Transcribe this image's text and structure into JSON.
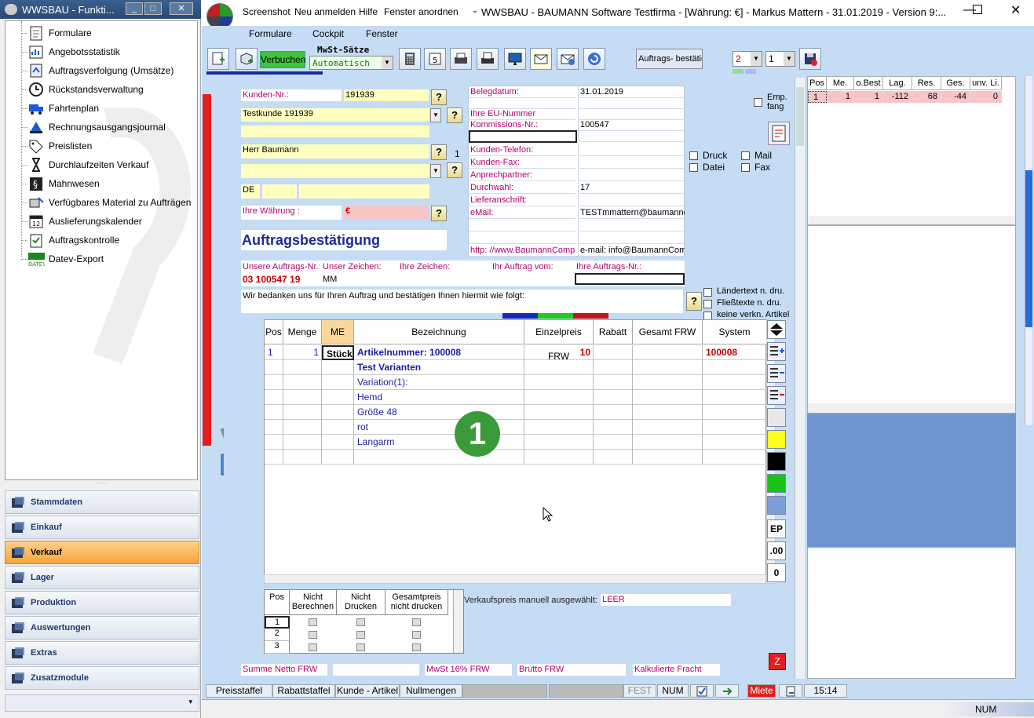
{
  "left_window": {
    "title": "WWSBAU - Funkti..."
  },
  "tree": [
    {
      "label": "Formulare",
      "icon": "document-icon"
    },
    {
      "label": "Angebotsstatistik",
      "icon": "statistics-icon"
    },
    {
      "label": "Auftragsverfolgung (Umsätze)",
      "icon": "tracking-icon"
    },
    {
      "label": "Rückstandsverwaltung",
      "icon": "clock-icon"
    },
    {
      "label": "Fahrtenplan",
      "icon": "truck-icon"
    },
    {
      "label": "Rechnungsausgangsjournal",
      "icon": "journal-icon"
    },
    {
      "label": "Preislisten",
      "icon": "tag-icon"
    },
    {
      "label": "Durchlaufzeiten Verkauf",
      "icon": "hourglass-icon"
    },
    {
      "label": "Mahnwesen",
      "icon": "paragraph-icon"
    },
    {
      "label": "Verfügbares Material zu Aufträgen",
      "icon": "material-icon"
    },
    {
      "label": "Auslieferungskalender",
      "icon": "calendar-icon"
    },
    {
      "label": "Auftragskontrolle",
      "icon": "clipboard-icon"
    },
    {
      "label": "Datev-Export",
      "icon": "datev-icon"
    }
  ],
  "nav": [
    {
      "label": "Stammdaten",
      "active": false
    },
    {
      "label": "Einkauf",
      "active": false
    },
    {
      "label": "Verkauf",
      "active": true
    },
    {
      "label": "Lager",
      "active": false
    },
    {
      "label": "Produktion",
      "active": false
    },
    {
      "label": "Auswertungen",
      "active": false
    },
    {
      "label": "Extras",
      "active": false
    },
    {
      "label": "Zusatzmodule",
      "active": false
    }
  ],
  "main_title": {
    "menu": [
      "Screenshot",
      "Neu anmelden",
      "Hilfe",
      "Fenster anordnen"
    ],
    "title": "WWSBAU - BAUMANN Software Testfirma - [Währung: €] -   Markus Mattern - 31.01.2019 - Version 9:..."
  },
  "menubar": [
    "Formulare",
    "Cockpit",
    "Fenster"
  ],
  "toolbar": {
    "verbuchen": "Verbuchen",
    "mwst_label": "MwSt-Sätze",
    "mwst_value": "Automatisch",
    "doc_type": "Auftrags- bestätig.",
    "copies1": "2",
    "copies2": "1"
  },
  "customer": {
    "kunden_nr_label": "Kunden-Nr.:",
    "kunden_nr": "191939",
    "name": "Testkunde 191939",
    "contact": "Herr Baumann",
    "country": "DE",
    "waehrung_label": "Ihre Währung :",
    "waehrung": "€",
    "addr_index": "1"
  },
  "doc_title": "Auftragsbestätigung",
  "info": [
    {
      "label": "Belegdatum:",
      "value": "31.01.2019"
    },
    {
      "label": "",
      "value": ""
    },
    {
      "label": "Ihre EU-Nummer",
      "value": ""
    },
    {
      "label": "Kommissions-Nr.:",
      "value": "100547"
    },
    {
      "label": "",
      "value": ""
    },
    {
      "label": "Kunden-Telefon:",
      "value": ""
    },
    {
      "label": "Kunden-Fax:",
      "value": ""
    },
    {
      "label": "Anprechpartner:",
      "value": ""
    },
    {
      "label": "Durchwahl:",
      "value": "17"
    },
    {
      "label": "Lieferanschrift:",
      "value": ""
    },
    {
      "label": "eMail:",
      "value": "TESTmmattern@baumannc"
    },
    {
      "label": "",
      "value": ""
    },
    {
      "label": "",
      "value": ""
    },
    {
      "label": "http: //www.BaumannCompu",
      "value": "e-mail: info@BaumannComp"
    }
  ],
  "options": {
    "druck": "Druck",
    "datei": "Datei",
    "mail": "Mail",
    "fax": "Fax",
    "empfang": "Emp. fang"
  },
  "refs": {
    "unsere_label": "Unsere Auftrags-Nr.:",
    "unsere": "03 100547 19",
    "zeichen_label": "Unser Zeichen:",
    "zeichen": "MM",
    "ihre_zeichen_label": "Ihre Zeichen:",
    "auftrag_vom_label": "Ihr Auftrag vom:",
    "ihre_nr_label": "Ihre Auftrags-Nr.:"
  },
  "intro_text": "Wir bedanken uns für Ihren Auftrag und bestätigen Ihnen hiermit wie folgt:",
  "text_options": [
    "Ländertext  n. dru.",
    "Fließtexte n. dru.",
    "keine verkn. Artikel"
  ],
  "grid": {
    "headers": [
      "Pos",
      "Menge",
      "ME",
      "Bezeichnung",
      "Einzelpreis FRW",
      "Rabatt",
      "Gesamt FRW",
      "System"
    ],
    "rows": [
      {
        "pos": "1",
        "menge": "1",
        "me": "Stück",
        "bez": "Artikelnummer: 100008",
        "preis": "10",
        "system": "100008"
      },
      {
        "bez": "Test Varianten"
      },
      {
        "bez": "Variation(1):"
      },
      {
        "bez": "Hemd"
      },
      {
        "bez": "Größe 48"
      },
      {
        "bez": "rot"
      },
      {
        "bez": "Langarm"
      },
      {
        "bez": ""
      }
    ],
    "badge": "1"
  },
  "side_buttons": [
    "EP",
    ".00",
    "0"
  ],
  "small_table": {
    "headers": [
      "Pos",
      "Nicht Berechnen",
      "Nicht Drucken",
      "Gesamtpreis nicht drucken"
    ],
    "rows": [
      "1",
      "2",
      "3"
    ]
  },
  "manual_price": {
    "label": "Verkaufspreis manuell ausgewählt:",
    "value": "LEER"
  },
  "totals": [
    "Summe Netto FRW",
    "MwSt 16% FRW",
    "Brutto FRW",
    "Kalkulierte Fracht"
  ],
  "stock_table": {
    "headers": [
      "Pos",
      "Me.",
      "o.Best",
      "Lag.",
      "Res.",
      "Ges.",
      "unv. Li."
    ],
    "row": [
      "1",
      "1",
      "1",
      "-112",
      "68",
      "-44",
      "0"
    ]
  },
  "statusbar": [
    "Preisstaffel",
    "Rabattstaffel",
    "Kunde - Artikel",
    "Nullmengen",
    "FEST",
    "NUM",
    "Miete",
    "15:14"
  ],
  "bottom_status": "NUM",
  "colors": {
    "window_bg": "#c5dcf4",
    "active_nav": "#f7a43a",
    "accent_red": "#c00000",
    "label_magenta": "#b0006e"
  }
}
